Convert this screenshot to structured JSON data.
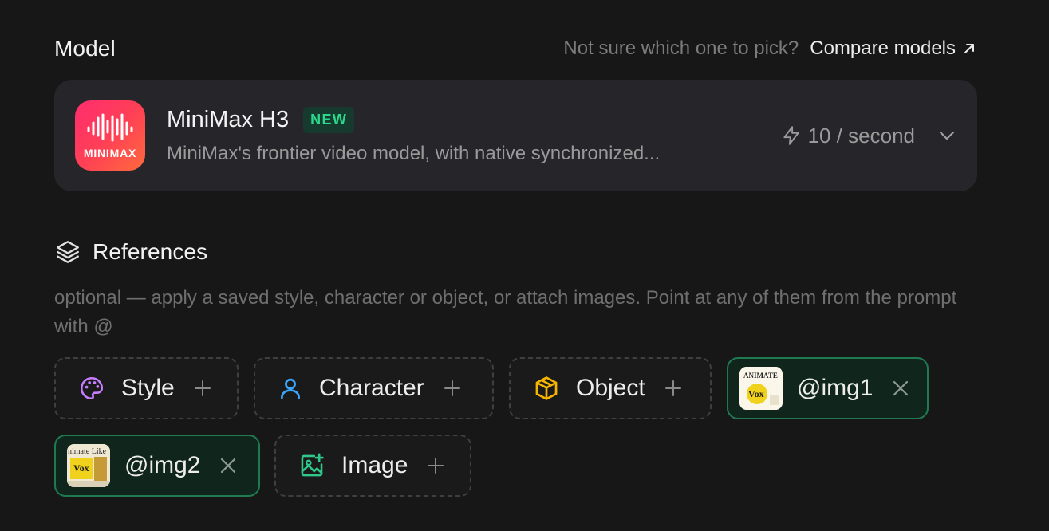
{
  "model_section": {
    "title": "Model",
    "compare_hint": "Not sure which one to pick?",
    "compare_link": "Compare models"
  },
  "model_card": {
    "logo_text": "MINIMAX",
    "name": "MiniMax H3",
    "badge": "NEW",
    "description": "MiniMax's frontier video model, with native synchronized...",
    "rate": "10 / second",
    "icons": {
      "rate": "bolt-icon",
      "expand": "chevron-down-icon"
    }
  },
  "references": {
    "title": "References",
    "icon": "layers-icon",
    "description": "optional — apply a saved style, character or object, or attach images. Point at any of them from the prompt with @",
    "chips": {
      "style": {
        "label": "Style",
        "icon": "palette-icon",
        "color": "#c77dff"
      },
      "character": {
        "label": "Character",
        "icon": "user-icon",
        "color": "#3ba7ff"
      },
      "object": {
        "label": "Object",
        "icon": "box-icon",
        "color": "#f5b400"
      },
      "img1": {
        "label": "@img1"
      },
      "img2": {
        "label": "@img2"
      },
      "image": {
        "label": "Image",
        "icon": "image-plus-icon",
        "color": "#2fc88a"
      }
    },
    "thumb_text": {
      "vox": "Vox",
      "animate": "ANIMATE",
      "animate_like": "nimate Like"
    }
  },
  "colors": {
    "accent": "#2bd98c",
    "background": "#171717",
    "card": "#26262a"
  }
}
